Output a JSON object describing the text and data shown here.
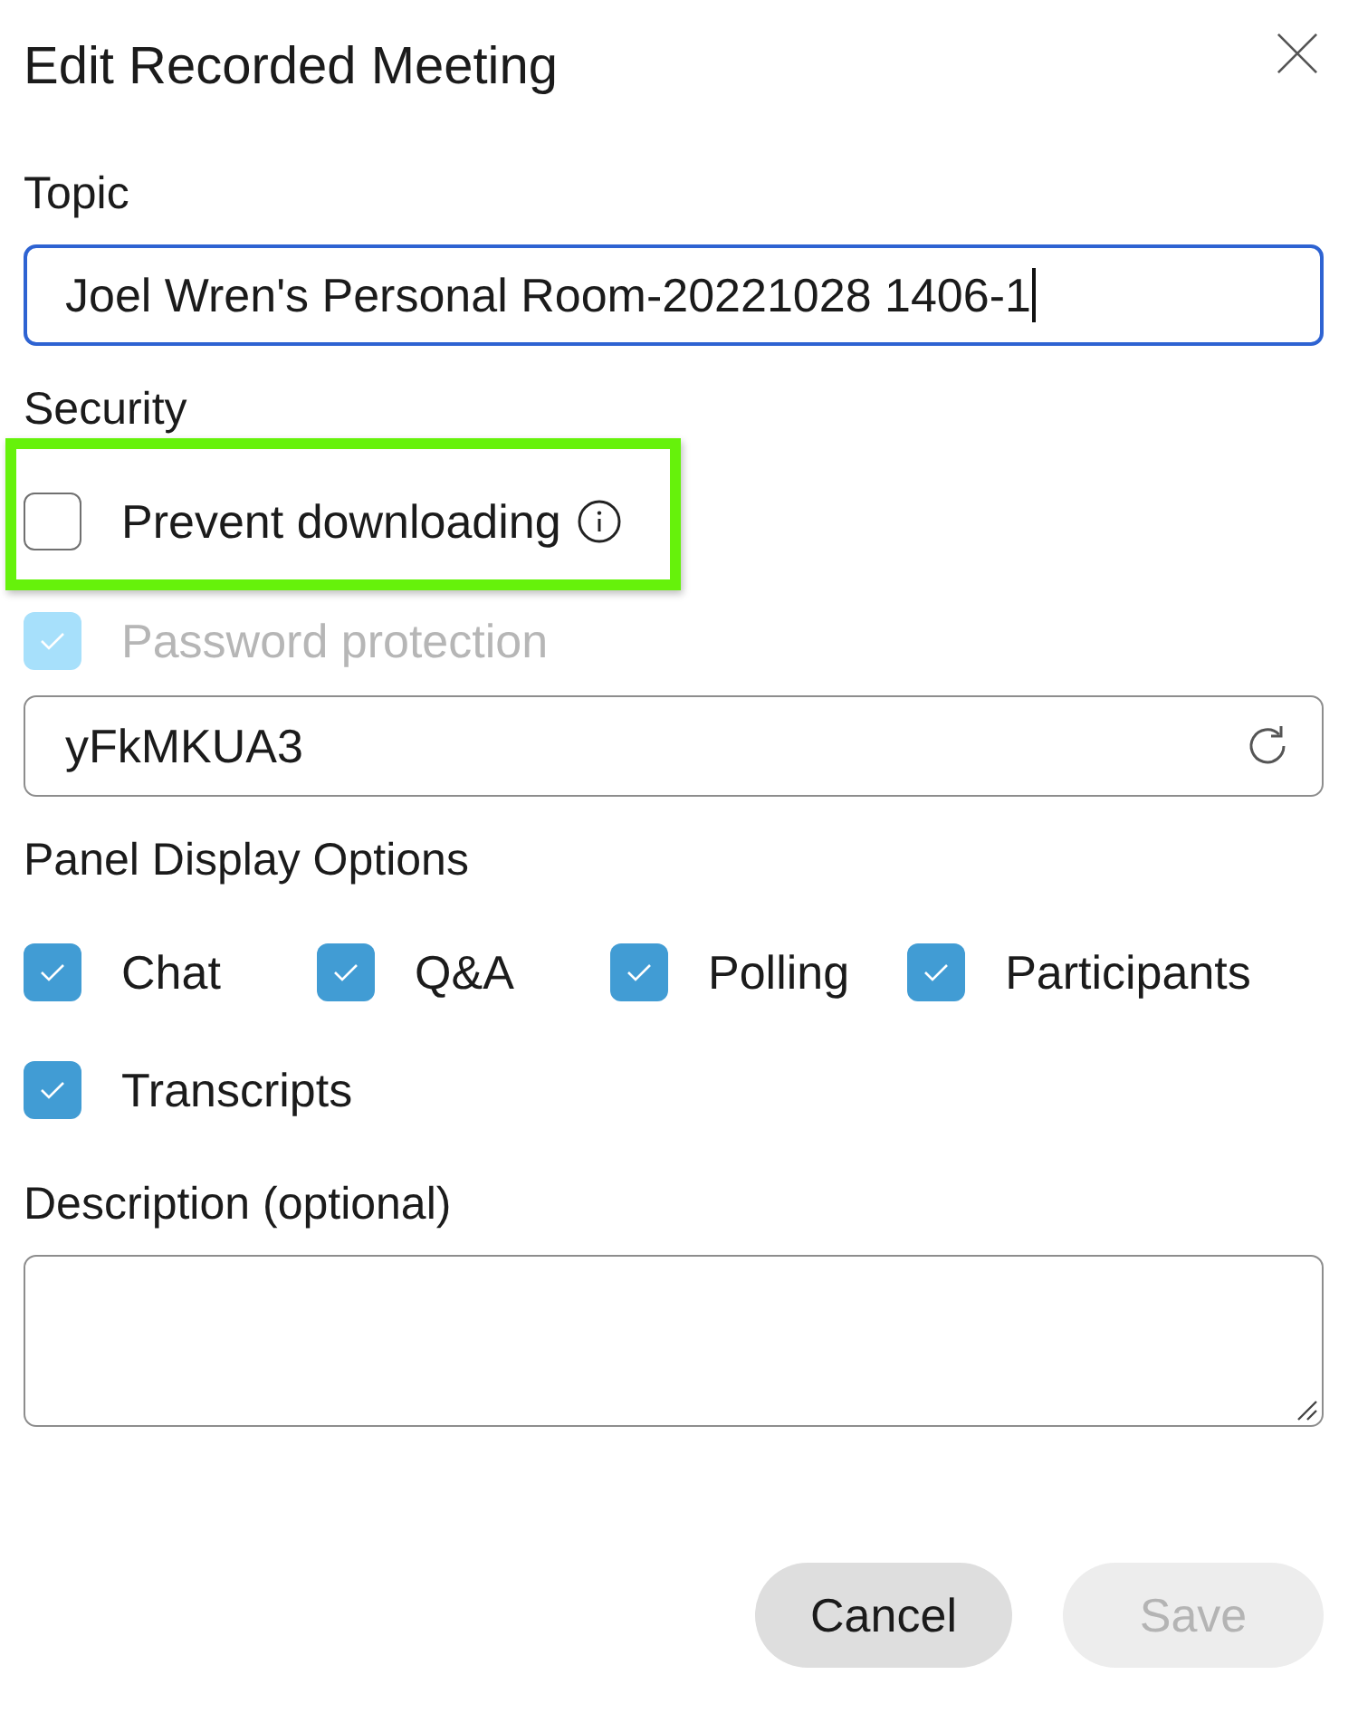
{
  "dialog": {
    "title": "Edit Recorded Meeting"
  },
  "topic": {
    "label": "Topic",
    "value": "Joel Wren's Personal Room-20221028 1406-1",
    "focused": true
  },
  "security": {
    "label": "Security",
    "options": [
      {
        "label": "Prevent downloading",
        "checked": false,
        "disabled": false,
        "highlighted": true,
        "info": true
      },
      {
        "label": "Password protection",
        "checked": true,
        "disabled": true,
        "highlighted": false,
        "info": false
      }
    ]
  },
  "password": {
    "value": "yFkMKUA3"
  },
  "panel_display": {
    "label": "Panel Display Options",
    "options": [
      {
        "label": "Chat",
        "checked": true
      },
      {
        "label": "Q&A",
        "checked": true
      },
      {
        "label": "Polling",
        "checked": true
      },
      {
        "label": "Participants",
        "checked": true
      },
      {
        "label": "Transcripts",
        "checked": true
      }
    ]
  },
  "description": {
    "label": "Description (optional)"
  },
  "buttons": [
    {
      "label": "Cancel",
      "disabled": false
    },
    {
      "label": "Save",
      "disabled": true
    }
  ]
}
